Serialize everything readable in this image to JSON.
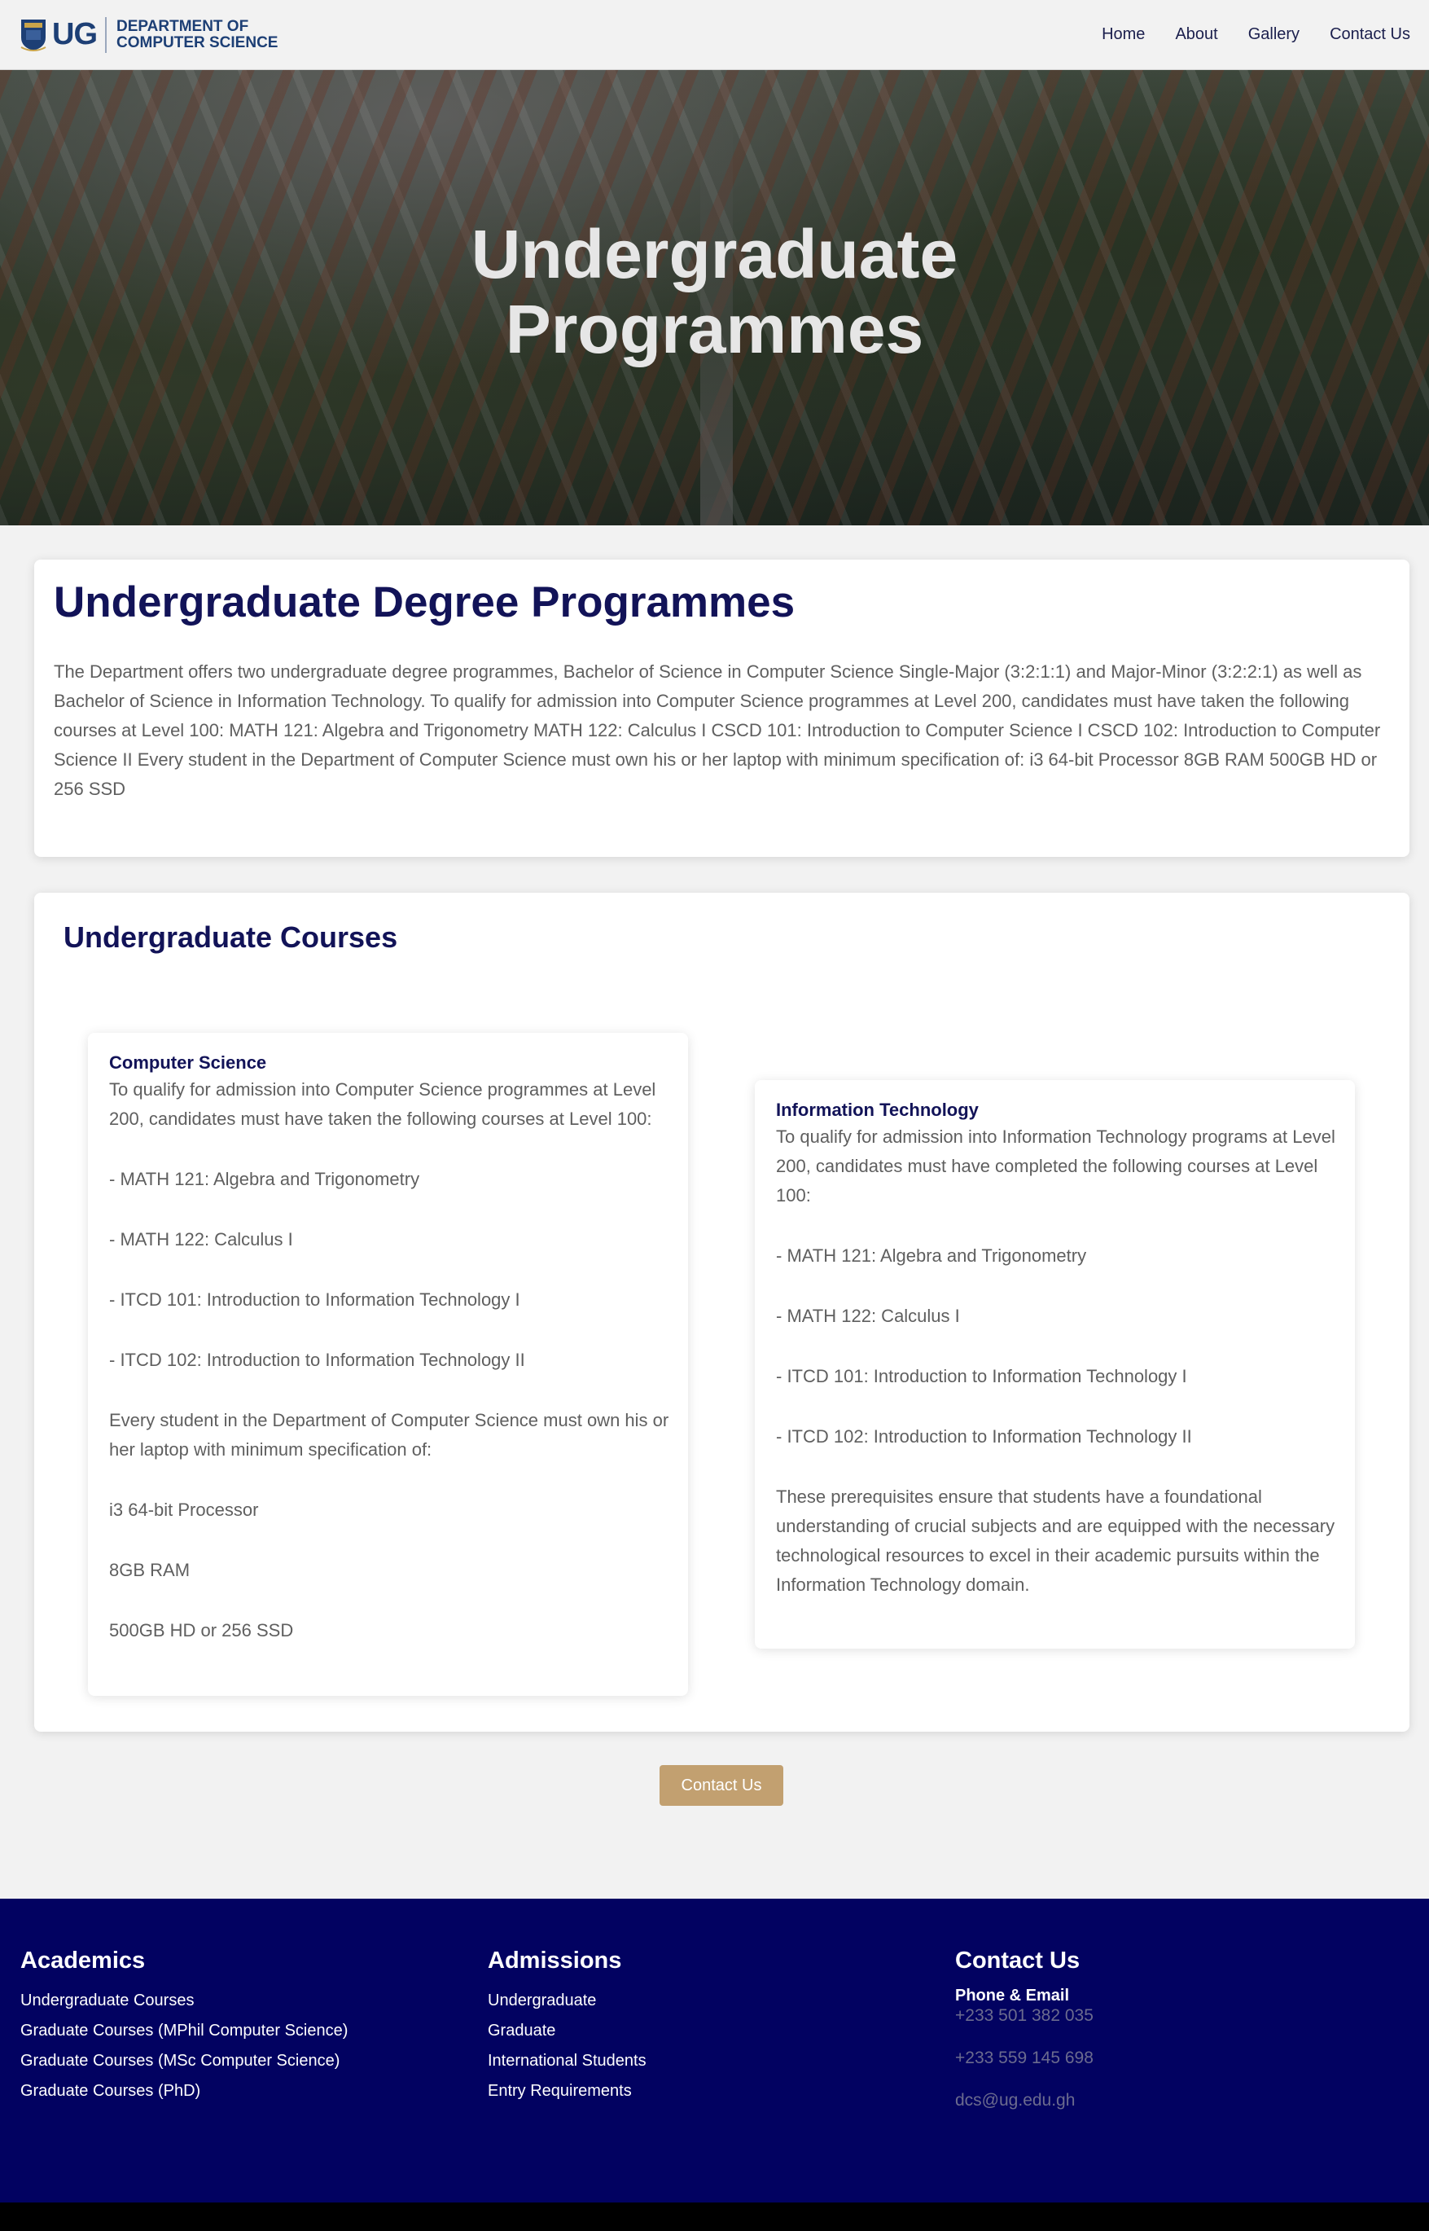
{
  "header": {
    "logo_text": "UG",
    "dept_line1": "DEPARTMENT OF",
    "dept_line2": "COMPUTER SCIENCE",
    "nav": [
      "Home",
      "About",
      "Gallery",
      "Contact Us"
    ]
  },
  "hero": {
    "line1": "Undergraduate",
    "line2": "Programmes"
  },
  "intro": {
    "title": "Undergraduate Degree Programmes",
    "text": "The Department offers two undergraduate degree programmes, Bachelor of Science in Computer Science Single-Major (3:2:1:1) and Major-Minor (3:2:2:1) as well as Bachelor of Science in Information Technology. To qualify for admission into Computer Science programmes at Level 200, candidates must have taken the following courses at Level 100: MATH 121: Algebra and Trigonometry MATH 122: Calculus I CSCD 101: Introduction to Computer Science I CSCD 102: Introduction to Computer Science II Every student in the Department of Computer Science must own his or her laptop with minimum specification of: i3 64-bit Processor 8GB RAM 500GB HD or 256 SSD"
  },
  "courses": {
    "title": "Undergraduate Courses",
    "cs": {
      "title": "Computer Science",
      "paragraphs": [
        "To qualify for admission into Computer Science programmes at Level 200, candidates must have taken the following courses at Level 100:",
        "- MATH 121: Algebra and Trigonometry",
        "- MATH 122: Calculus I",
        "- ITCD 101: Introduction to Information Technology I",
        "- ITCD 102: Introduction to Information Technology II",
        "Every student in the Department of Computer Science must own his or her laptop with minimum specification of:",
        "i3 64-bit Processor",
        "8GB RAM",
        "500GB HD or 256 SSD"
      ]
    },
    "it": {
      "title": "Information Technology",
      "paragraphs": [
        "To qualify for admission into Information Technology programs at Level 200, candidates must have completed the following courses at Level 100:",
        "- MATH 121: Algebra and Trigonometry",
        "- MATH 122: Calculus I",
        "- ITCD 101: Introduction to Information Technology I",
        "- ITCD 102: Introduction to Information Technology II",
        "These prerequisites ensure that students have a foundational understanding of crucial subjects and are equipped with the necessary technological resources to excel in their academic pursuits within the Information Technology domain."
      ]
    }
  },
  "cta": {
    "label": "Contact Us",
    "color": "#c2a070"
  },
  "footer": {
    "academics": {
      "title": "Academics",
      "links": [
        "Undergraduate Courses",
        "Graduate Courses (MPhil Computer Science)",
        "Graduate Courses (MSc Computer Science)",
        "Graduate Courses (PhD)"
      ]
    },
    "admissions": {
      "title": "Admissions",
      "links": [
        "Undergraduate",
        "Graduate",
        "International Students",
        "Entry Requirements"
      ]
    },
    "contact": {
      "title": "Contact Us",
      "label": "Phone & Email",
      "phone1": "+233 501 382 035",
      "phone2": "+233 559 145 698",
      "email": "dcs@ug.edu.gh"
    },
    "bg_color": "#020261"
  }
}
